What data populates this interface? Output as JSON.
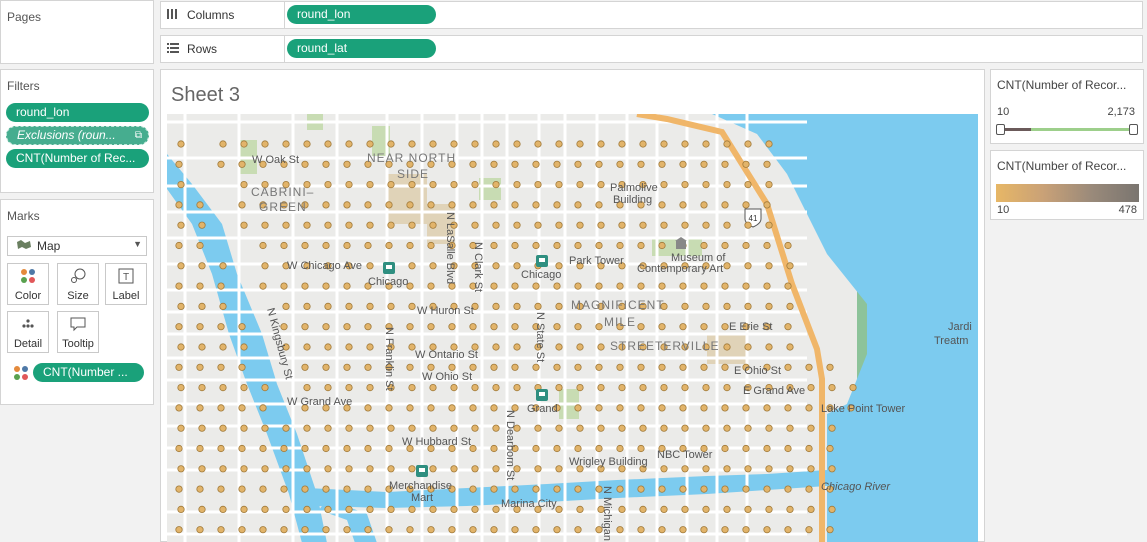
{
  "pages": {
    "title": "Pages"
  },
  "columns": {
    "label": "Columns",
    "pill": "round_lon"
  },
  "rows": {
    "label": "Rows",
    "pill": "round_lat"
  },
  "filters": {
    "title": "Filters",
    "items": [
      {
        "label": "round_lon"
      },
      {
        "label": "Exclusions (roun..."
      },
      {
        "label": "CNT(Number of Rec..."
      }
    ]
  },
  "marks": {
    "title": "Marks",
    "mark_type": "Map",
    "buttons": {
      "color": "Color",
      "size": "Size",
      "label": "Label",
      "detail": "Detail",
      "tooltip": "Tooltip"
    },
    "color_pill": "CNT(Number ..."
  },
  "sheet": {
    "title": "Sheet 3"
  },
  "filter_legend": {
    "title": "CNT(Number of Recor...",
    "min": "10",
    "max": "2,173"
  },
  "color_legend": {
    "title": "CNT(Number of Recor...",
    "min": "10",
    "max": "478"
  },
  "map": {
    "labels": {
      "near_north_side_1": "NEAR NORTH",
      "near_north_side_2": "SIDE",
      "cabrini_1": "CABRINI–",
      "cabrini_2": "GREEN",
      "w_oak_st": "W Oak St",
      "w_chicago_ave": "W Chicago Ave",
      "chicago_1": "Chicago",
      "chicago_2": "Chicago",
      "park_tower": "Park Tower",
      "palmolive_1": "Palmolive",
      "palmolive_2": "Building",
      "museum_1": "Museum of",
      "museum_2": "Contemporary Art",
      "n_lasalle": "N LaSalle Blvd",
      "n_clark": "N Clark St",
      "n_state": "N State St",
      "n_kingsbury": "N Kingsbury St",
      "n_franklin": "N Franklin St",
      "w_huron": "W Huron St",
      "w_ontario": "W Ontario St",
      "w_ohio": "W Ohio St",
      "w_grand": "W Grand Ave",
      "w_hubbard": "W Hubbard St",
      "n_dearborn": "N Dearborn St",
      "n_michigan": "N Michigan",
      "magnificent_1": "MAGNIFICENT",
      "magnificent_2": "MILE",
      "streeterville": "STREETERVILLE",
      "e_erie": "E Erie St",
      "e_ohio": "E Ohio St",
      "e_grand": "E Grand Ave",
      "lake_point": "Lake Point Tower",
      "grand": "Grand",
      "nbc_tower": "NBC Tower",
      "wrigley": "Wrigley Building",
      "merchandise_1": "Merchandise",
      "merchandise_2": "Mart",
      "marina": "Marina City",
      "chicago_river": "Chicago River",
      "jardine_1": "Jardi",
      "jardine_2": "Treatm",
      "hwy": "41"
    }
  },
  "colors": {
    "pill": "#1aa17a",
    "water": "#7ccbef",
    "mark_fill": "#e2b46a",
    "mark_stroke": "#a07a3a"
  }
}
